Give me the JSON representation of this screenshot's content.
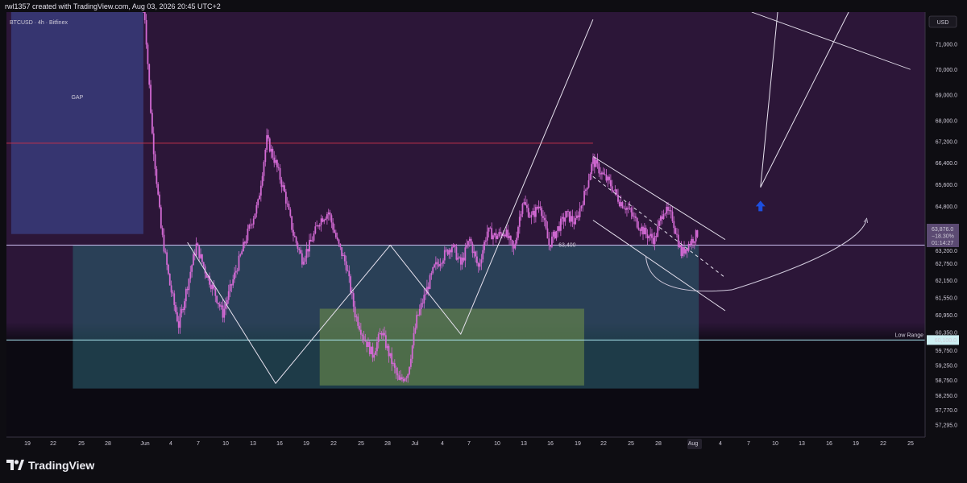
{
  "header": {
    "attribution": "rwl1357 created with TradingView.com, Aug 03, 2026 20:45 UTC+2"
  },
  "footer": {
    "brand": "TradingView",
    "logo_icon": "tradingview-logo-icon"
  },
  "chart_data": {
    "type": "candlestick",
    "symbol_title": "BTCUSD · 4h · Bitfinex",
    "currency": "USD",
    "colors": {
      "background_top": "#2c1638",
      "background_bottom": "#0c0a12",
      "candles": "#d36ad4",
      "gap_zone": "#3a3d7e",
      "range_zone": "#2a5a6a",
      "support_zone": "#6a8a4a",
      "resistance_line": "#c0304a",
      "arrow": "#1d4fe0"
    },
    "y_axis": {
      "scale": "log",
      "range": [
        56900,
        72300
      ],
      "ticks": [
        "71,000.0",
        "70,000.0",
        "69,000.0",
        "68,000.0",
        "67,200.0",
        "66,400.0",
        "65,600.0",
        "64,800.0",
        "64,000.0",
        "63,200.0",
        "62,750.0",
        "62,150.0",
        "61,550.0",
        "60,950.0",
        "60,350.0",
        "59,750.0",
        "59,250.0",
        "58,750.0",
        "58,250.0",
        "57,770.0",
        "57,295.0"
      ]
    },
    "x_axis": {
      "ticks": [
        "19",
        "22",
        "25",
        "28",
        "Jun",
        "4",
        "7",
        "10",
        "13",
        "16",
        "19",
        "22",
        "25",
        "28",
        "Jul",
        "4",
        "7",
        "10",
        "13",
        "16",
        "19",
        "22",
        "25",
        "28",
        "Aug",
        "4",
        "7",
        "10",
        "13",
        "16",
        "19",
        "22",
        "25"
      ]
    },
    "price_path": [
      [
        "Jun 1",
        73000
      ],
      [
        "Jun 2",
        67500
      ],
      [
        "Jun 3",
        64000
      ],
      [
        "Jun 4",
        62000
      ],
      [
        "Jun 5",
        60600
      ],
      [
        "Jun 6",
        62000
      ],
      [
        "Jun 7",
        63400
      ],
      [
        "Jun 8",
        62500
      ],
      [
        "Jun 9",
        61800
      ],
      [
        "Jun 10",
        61000
      ],
      [
        "Jun 11",
        62000
      ],
      [
        "Jun 12",
        63000
      ],
      [
        "Jun 13",
        64000
      ],
      [
        "Jun 14",
        64900
      ],
      [
        "Jun 15",
        67300
      ],
      [
        "Jun 16",
        66400
      ],
      [
        "Jun 17",
        65300
      ],
      [
        "Jun 18",
        63800
      ],
      [
        "Jun 19",
        62900
      ],
      [
        "Jun 20",
        63500
      ],
      [
        "Jun 21",
        64300
      ],
      [
        "Jun 22",
        64600
      ],
      [
        "Jun 23",
        63500
      ],
      [
        "Jun 24",
        62700
      ],
      [
        "Jun 25",
        61000
      ],
      [
        "Jun 26",
        60200
      ],
      [
        "Jun 27",
        59600
      ],
      [
        "Jun 28",
        60400
      ],
      [
        "Jun 29",
        59500
      ],
      [
        "Jun 30",
        58700
      ],
      [
        "Jul 1",
        59000
      ],
      [
        "Jul 2",
        60800
      ],
      [
        "Jul 3",
        61700
      ],
      [
        "Jul 4",
        62600
      ],
      [
        "Jul 5",
        63000
      ],
      [
        "Jul 6",
        63400
      ],
      [
        "Jul 7",
        62700
      ],
      [
        "Jul 8",
        63600
      ],
      [
        "Jul 9",
        62600
      ],
      [
        "Jul 10",
        63900
      ],
      [
        "Jul 11",
        63700
      ],
      [
        "Jul 12",
        63900
      ],
      [
        "Jul 13",
        63200
      ],
      [
        "Jul 14",
        65000
      ],
      [
        "Jul 15",
        64400
      ],
      [
        "Jul 16",
        64900
      ],
      [
        "Jul 17",
        63400
      ],
      [
        "Jul 18",
        64000
      ],
      [
        "Jul 19",
        64500
      ],
      [
        "Jul 20",
        64200
      ],
      [
        "Jul 21",
        65200
      ],
      [
        "Jul 22",
        66500
      ],
      [
        "Jul 23",
        66000
      ],
      [
        "Jul 24",
        65600
      ],
      [
        "Jul 25",
        65000
      ],
      [
        "Jul 26",
        64700
      ],
      [
        "Jul 27",
        64200
      ],
      [
        "Jul 28",
        63800
      ],
      [
        "Jul 29",
        63600
      ],
      [
        "Jul 30",
        64700
      ],
      [
        "Jul 31",
        64400
      ],
      [
        "Aug 1",
        63100
      ],
      [
        "Aug 2",
        63500
      ],
      [
        "Aug 3",
        63876
      ]
    ],
    "zones": [
      {
        "name": "gap",
        "label": "GAP",
        "from": "May 17",
        "to": "Jun 1",
        "price_low": 63800,
        "price_high": 72300
      },
      {
        "name": "range",
        "label": "",
        "from": "May 24",
        "to": "Aug 3",
        "price_low": 58480,
        "price_high": 63400
      },
      {
        "name": "support",
        "label": "",
        "from": "Jun 21",
        "to": "Jul 21",
        "price_low": 58580,
        "price_high": 61170
      }
    ],
    "horizontal_lines": [
      {
        "name": "resistance",
        "price": 67150,
        "label": ""
      },
      {
        "name": "mid-line",
        "price": 63400,
        "label": "63,400"
      },
      {
        "name": "low-range",
        "price": 60100,
        "label": "Low Range"
      }
    ],
    "current_price": {
      "price": "63,876.0",
      "change": "−18.30%",
      "countdown": "01:14:27"
    },
    "low_range_tag": "60,100.0",
    "annotations": [
      {
        "type": "zigzag-projection",
        "points": [
          [
            "Jun 6",
            63500
          ],
          [
            "Jun 16",
            58650
          ],
          [
            "Jun 29",
            63400
          ],
          [
            "Jul 7",
            60300
          ],
          [
            "Jul 22",
            72000
          ]
        ]
      },
      {
        "type": "projection-path",
        "points": [
          [
            "Aug 12",
            72500
          ],
          [
            "Aug 10",
            65500
          ],
          [
            "Aug 20",
            72300
          ]
        ]
      },
      {
        "type": "descending-channel",
        "upper": [
          [
            "Jul 22",
            66650
          ],
          [
            "Aug 6",
            63600
          ]
        ],
        "lower": [
          [
            "Jul 22",
            64300
          ],
          [
            "Aug 6",
            61100
          ]
        ]
      },
      {
        "type": "dashed-trend",
        "points": [
          [
            "Jul 22",
            65900
          ],
          [
            "Aug 6",
            62250
          ]
        ]
      },
      {
        "type": "curve-arrow",
        "points": [
          [
            "Jul 28",
            63000
          ],
          [
            "Aug 4",
            61880
          ],
          [
            "Aug 22",
            64300
          ]
        ]
      },
      {
        "type": "up-arrow",
        "at": [
          "Aug 10",
          64800
        ]
      },
      {
        "type": "trend-line",
        "points": [
          [
            "Aug 9",
            72300
          ],
          [
            "Aug 27",
            70000
          ]
        ]
      }
    ]
  }
}
